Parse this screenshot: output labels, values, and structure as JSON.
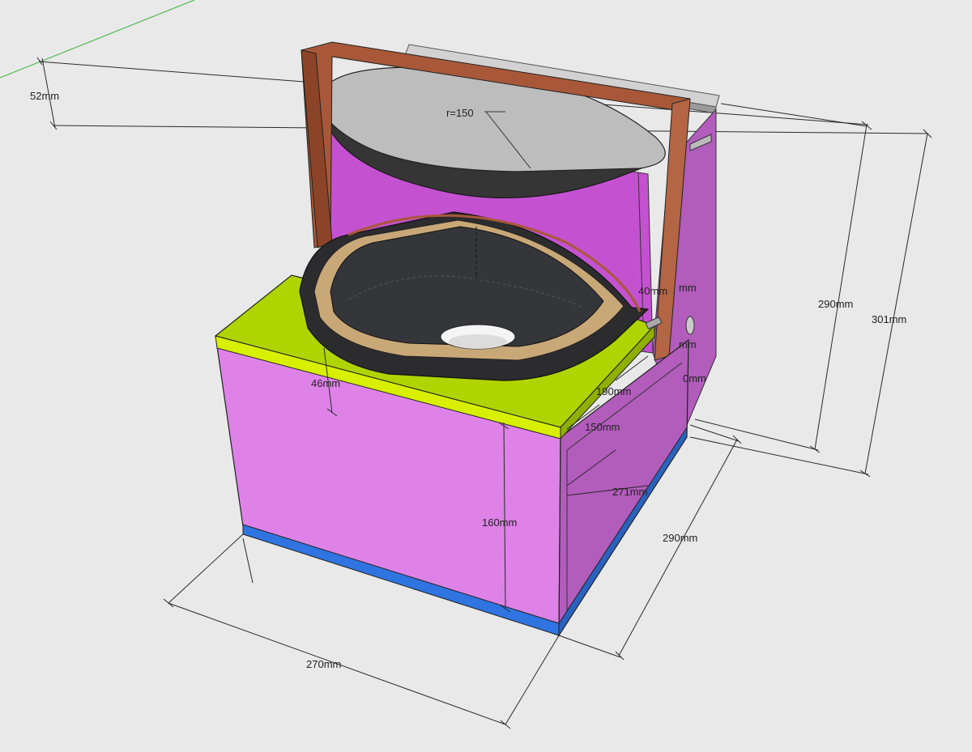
{
  "dimensions": {
    "top_offset": "52mm",
    "radius": "r=150",
    "right_height_inner": "290mm",
    "right_height_outer": "301mm",
    "inner_40": "40mm",
    "inner_mm_1": "mm",
    "inner_mm_2": "mm",
    "inner_mm_3": "0mm",
    "lid_thickness": "46mm",
    "inner_190": "190mm",
    "inner_150": "150mm",
    "inner_271": "271mm",
    "front_height": "160mm",
    "depth": "290mm",
    "width": "270mm"
  },
  "colors": {
    "background": "#e9e9e9",
    "box_front": "#de82e8",
    "box_side": "#b25cbc",
    "top_plate": "#b0d400",
    "base_strip": "#2f74e0",
    "handle": "#a85838",
    "bowl": "#2e2e32",
    "hood": "#bdbdbd",
    "inner_panel": "#c451d0"
  },
  "icons": {
    "drain_hole": "drain-hole-icon",
    "vent": "side-vent-icon"
  }
}
